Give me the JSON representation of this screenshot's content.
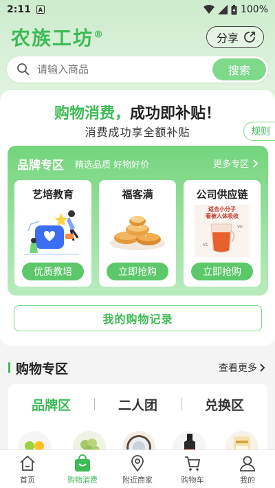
{
  "status": {
    "time": "2:11",
    "notif_letter": "A",
    "battery": "100%"
  },
  "header": {
    "logo": "农族工坊",
    "logo_mark": "®",
    "share_label": "分享"
  },
  "search": {
    "placeholder": "请输入商品",
    "button": "搜索"
  },
  "promo": {
    "headline_green": "购物消费，",
    "headline_black": "成功即补贴！",
    "subtitle": "消费成功享全额补贴",
    "rules": "规则"
  },
  "brand_zone": {
    "title": "品牌专区",
    "subtitle": "精选品质 好物好价",
    "more": "更多专区",
    "items": [
      {
        "name": "艺培教育",
        "button": "优质教培"
      },
      {
        "name": "福客满",
        "button": "立即抢购"
      },
      {
        "name": "公司供应链",
        "button": "立即抢购"
      }
    ],
    "poster_text_line1": "适合小分子",
    "poster_text_line2": "看被人体吸收",
    "poster_vc": "VC",
    "poster_ve": "VE"
  },
  "records_button": "我的购物记录",
  "shop": {
    "title": "购物专区",
    "more": "查看更多",
    "tabs": [
      "品牌区",
      "二人团",
      "兑换区"
    ],
    "active_tab": 0
  },
  "tabbar": [
    {
      "label": "首页",
      "icon": "home-icon"
    },
    {
      "label": "购物消费",
      "icon": "shopping-bag-icon"
    },
    {
      "label": "附近商家",
      "icon": "location-pin-icon"
    },
    {
      "label": "购物车",
      "icon": "cart-icon"
    },
    {
      "label": "我的",
      "icon": "user-icon"
    }
  ],
  "colors": {
    "accent": "#3dbb55",
    "accent_light": "#7fd98a",
    "brand_zone": "#73d57c"
  }
}
